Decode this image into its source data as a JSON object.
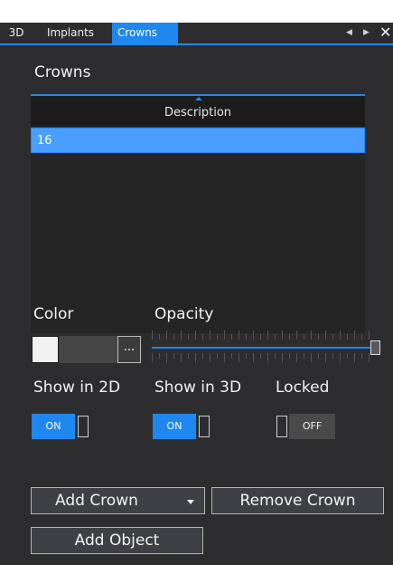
{
  "tabs": [
    {
      "label": "3D",
      "active": false
    },
    {
      "label": "Implants",
      "active": false
    },
    {
      "label": "Crowns",
      "active": true
    }
  ],
  "tab_controls": {
    "prev_icon": "caret-left-icon",
    "next_icon": "caret-right-icon",
    "close_icon": "close-icon"
  },
  "panel": {
    "title": "Crowns",
    "list": {
      "header": "Description",
      "rows": [
        "16"
      ],
      "selected_index": 0
    },
    "color": {
      "label": "Color",
      "value": "#f2f2f2",
      "more_label": "..."
    },
    "opacity": {
      "label": "Opacity",
      "value": 1.0
    },
    "toggles": [
      {
        "label": "Show in 2D",
        "state": "ON"
      },
      {
        "label": "Show in 3D",
        "state": "ON"
      },
      {
        "label": "Locked",
        "state": "OFF"
      }
    ],
    "buttons": {
      "add_crown": "Add Crown",
      "remove_crown": "Remove Crown",
      "add_object": "Add Object"
    }
  },
  "colors": {
    "accent": "#1e87f0",
    "background": "#2d2d30",
    "selection": "#4a9eff"
  }
}
